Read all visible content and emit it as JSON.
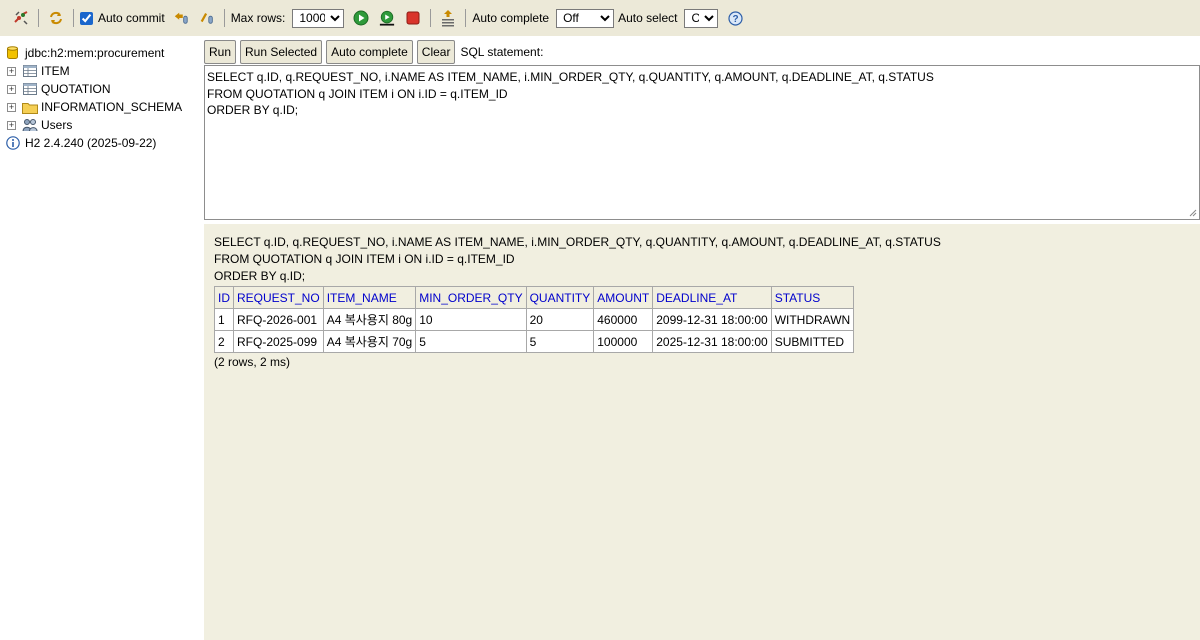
{
  "toolbar": {
    "auto_commit_label": "Auto commit",
    "auto_commit_checked": true,
    "max_rows_label": "Max rows:",
    "max_rows_value": "1000",
    "auto_complete_label": "Auto complete",
    "auto_complete_value": "Off",
    "auto_select_label": "Auto select",
    "auto_select_value": "On",
    "help_glyph": "?"
  },
  "tree": {
    "connection": "jdbc:h2:mem:procurement",
    "items": [
      {
        "label": "ITEM",
        "icon": "table-icon"
      },
      {
        "label": "QUOTATION",
        "icon": "table-icon"
      },
      {
        "label": "INFORMATION_SCHEMA",
        "icon": "folder-icon"
      },
      {
        "label": "Users",
        "icon": "users-icon"
      }
    ],
    "version": "H2 2.4.240 (2025-09-22)"
  },
  "sql": {
    "buttons": {
      "run": "Run",
      "run_selected": "Run Selected",
      "auto_complete": "Auto complete",
      "clear": "Clear"
    },
    "label": "SQL statement:",
    "text": "SELECT q.ID, q.REQUEST_NO, i.NAME AS ITEM_NAME, i.MIN_ORDER_QTY, q.QUANTITY, q.AMOUNT, q.DEADLINE_AT, q.STATUS\nFROM QUOTATION q JOIN ITEM i ON i.ID = q.ITEM_ID\nORDER BY q.ID;"
  },
  "result": {
    "sql_echo": "SELECT q.ID, q.REQUEST_NO, i.NAME AS ITEM_NAME, i.MIN_ORDER_QTY, q.QUANTITY, q.AMOUNT, q.DEADLINE_AT, q.STATUS\nFROM QUOTATION q JOIN ITEM i ON i.ID = q.ITEM_ID\nORDER BY q.ID;",
    "columns": [
      "ID",
      "REQUEST_NO",
      "ITEM_NAME",
      "MIN_ORDER_QTY",
      "QUANTITY",
      "AMOUNT",
      "DEADLINE_AT",
      "STATUS"
    ],
    "rows": [
      [
        "1",
        "RFQ-2026-001",
        "A4 복사용지 80g",
        "10",
        "20",
        "460000",
        "2099-12-31 18:00:00",
        "WITHDRAWN"
      ],
      [
        "2",
        "RFQ-2025-099",
        "A4 복사용지 70g",
        "5",
        "5",
        "100000",
        "2025-12-31 18:00:00",
        "SUBMITTED"
      ]
    ],
    "summary": "(2 rows, 2 ms)"
  },
  "colors": {
    "toolbar_bg": "#ece9d8",
    "result_bg": "#f1efe0",
    "header_text": "#0000cc"
  }
}
